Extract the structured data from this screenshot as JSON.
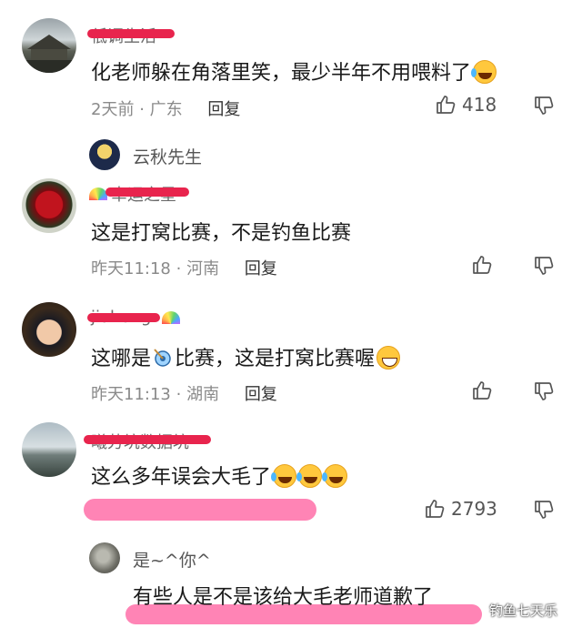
{
  "comments": [
    {
      "username": "低调生活",
      "content": "化老师躲在角落里笑，最少半年不用喂料了",
      "time": "2天前",
      "location": "广东",
      "reply_label": "回复",
      "likes": "418",
      "sub_reply_user": "云秋先生"
    },
    {
      "username": "幸运之星",
      "content": "这是打窝比赛，不是钓鱼比赛",
      "time": "昨天11:18",
      "location": "河南",
      "reply_label": "回复"
    },
    {
      "username": "jiahong",
      "content_pre": "这哪是",
      "content_post": "比赛，这是打窝比赛喔",
      "time": "昨天11:13",
      "location": "湖南",
      "reply_label": "回复"
    },
    {
      "username": "曦芳坑数据坑",
      "content": "这么多年误会大毛了",
      "likes": "2793",
      "sub_reply_user": "是~^你^",
      "sub_reply_content": "有些人是不是该给大毛老师道歉了"
    }
  ],
  "meta_separator": "·",
  "watermark": "钓鱼七天乐",
  "colors": {
    "scribble": "#e8244d",
    "highlight": "#ff6fa8",
    "meta": "#8a8a8a"
  }
}
